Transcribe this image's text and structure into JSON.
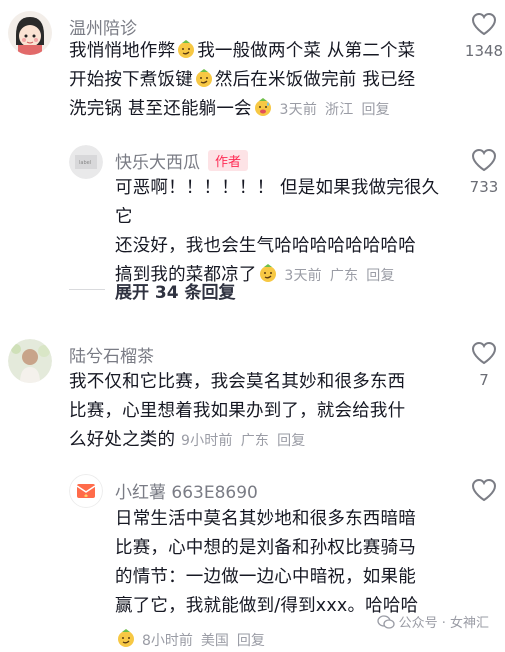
{
  "comments": [
    {
      "user": "温州陪诊",
      "lines": [
        "我悄悄地作弊",
        "我一般做两个菜 从第二个菜",
        "开始按下煮饭键",
        "然后在米饭做完前 我已经",
        "洗完锅  甚至还能躺一会"
      ],
      "time": "3天前",
      "location": "浙江",
      "reply": "回复",
      "likes": "1348",
      "emoji_icons": [
        "smug-face-icon",
        "smug-face-icon",
        "sweat-face-icon"
      ]
    },
    {
      "user": "快乐大西瓜",
      "badge": "作者",
      "lines": [
        "可恶啊！！！！！！ 但是如果我做完很久它",
        "还没好，我也会生气哈哈哈哈哈哈哈哈",
        "搞到我的菜都凉了"
      ],
      "time": "3天前",
      "location": "广东",
      "reply": "回复",
      "likes": "733",
      "emoji_icons": [
        "smug-face-icon"
      ]
    },
    {
      "user": "陆兮石榴茶",
      "lines": [
        "我不仅和它比赛，我会莫名其妙和很多东西",
        "比赛，心里想着我如果办到了，就会给我什",
        "么好处之类的"
      ],
      "time": "9小时前",
      "location": "广东",
      "reply": "回复",
      "likes": "7"
    },
    {
      "user": "小红薯 663E8690",
      "lines": [
        "日常生活中莫名其妙地和很多东西暗暗",
        "比赛，心中想的是刘备和孙权比赛骑马",
        "的情节：一边做一边心中暗祝，如果能",
        "赢了它，我就能做到/得到xxx。哈哈哈"
      ],
      "time": "8小时前",
      "location": "美国",
      "reply": "回复",
      "emoji_icons": [
        "smug-face-icon"
      ]
    }
  ],
  "expand_replies": "展开 34 条回复",
  "watermark": "公众号 · 女神汇",
  "colors": {
    "accent": "#fe2c55",
    "meta": "#9a9ca5",
    "text": "#161823"
  }
}
